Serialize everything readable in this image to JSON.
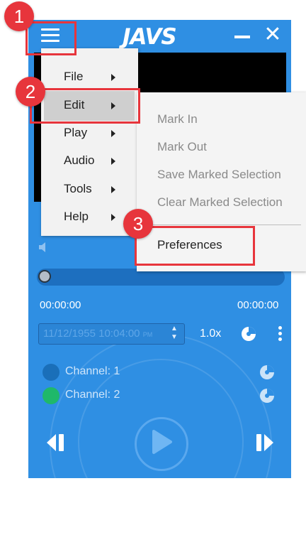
{
  "app": {
    "logo_text": "JAVS"
  },
  "player": {
    "time_start": "00:00:00",
    "time_end": "00:00:00",
    "datetime_value": "11/12/1955 10:04:00",
    "datetime_ampm": "PM",
    "speed": "1.0x",
    "channels": [
      {
        "label": "Channel: 1",
        "color": "#1a6fb9"
      },
      {
        "label": "Channel: 2",
        "color": "#1fb86a"
      }
    ]
  },
  "main_menu": {
    "items": [
      {
        "label": "File"
      },
      {
        "label": "Edit"
      },
      {
        "label": "Play"
      },
      {
        "label": "Audio"
      },
      {
        "label": "Tools"
      },
      {
        "label": "Help"
      }
    ]
  },
  "edit_submenu": {
    "items": [
      {
        "label": "Mark In",
        "enabled": false
      },
      {
        "label": "Mark Out",
        "enabled": false
      },
      {
        "label": "Save Marked Selection",
        "enabled": false
      },
      {
        "label": "Clear Marked Selection",
        "enabled": false
      },
      {
        "label": "Preferences",
        "enabled": true
      }
    ]
  },
  "callouts": {
    "step1": "1",
    "step2": "2",
    "step3": "3"
  },
  "colors": {
    "player_bg": "#2f8fe3",
    "callout_red": "#e7353c",
    "menu_bg": "#f2f2f2",
    "disabled_text": "#8a8a8a"
  }
}
